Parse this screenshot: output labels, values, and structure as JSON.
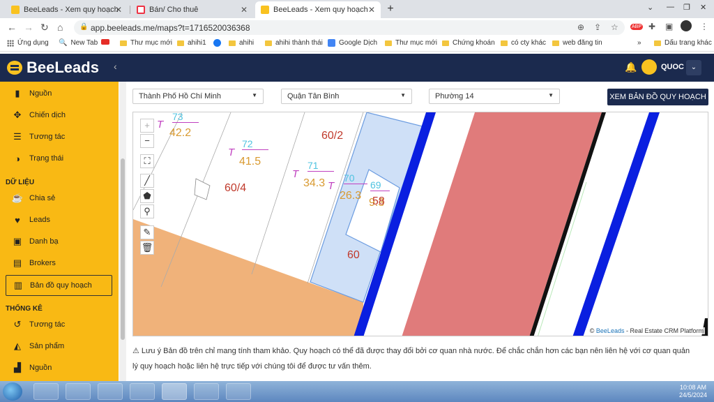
{
  "browser": {
    "tabs": [
      {
        "title": "BeeLeads - Xem quy hoạch",
        "active": false
      },
      {
        "title": "Bán/ Cho thuê",
        "active": false
      },
      {
        "title": "BeeLeads - Xem quy hoạch",
        "active": true
      }
    ],
    "url": "app.beeleads.me/maps?t=1716520036368",
    "bookmarks": [
      "Ứng dụng",
      "New Tab",
      "",
      "Thư mục mới",
      "ahihi1",
      "",
      "ahihi",
      "ahihi thành thái",
      "Google Dịch",
      "Thư mục mới",
      "Chứng khoán",
      "có cty khác",
      "web đăng tin"
    ],
    "more_bookmarks": "»",
    "other_bookmarks": "Dấu trang khác"
  },
  "header": {
    "logo": "BeeLeads",
    "user": "QUOC"
  },
  "sidebar": {
    "items_top": [
      {
        "label": "Nguồn",
        "icon": "bookmark-icon"
      },
      {
        "label": "Chiến dịch",
        "icon": "crosshair-icon"
      },
      {
        "label": "Tương tác",
        "icon": "list-icon"
      },
      {
        "label": "Trạng thái",
        "icon": "half-circle-icon"
      }
    ],
    "section_data": "DỮ LIỆU",
    "items_data": [
      {
        "label": "Chia sẻ",
        "icon": "coffee-icon"
      },
      {
        "label": "Leads",
        "icon": "heartbeat-icon"
      },
      {
        "label": "Danh bạ",
        "icon": "contact-icon"
      },
      {
        "label": "Brokers",
        "icon": "card-icon"
      },
      {
        "label": "Bản đồ quy hoạch",
        "icon": "map-icon",
        "active": true
      }
    ],
    "section_stats": "THỐNG KÊ",
    "items_stats": [
      {
        "label": "Tương tác",
        "icon": "history-icon"
      },
      {
        "label": "Sản phẩm",
        "icon": "area-chart-icon"
      },
      {
        "label": "Nguồn",
        "icon": "bar-chart-icon"
      }
    ]
  },
  "filters": {
    "city": "Thành Phố Hồ Chí Minh",
    "district": "Quận Tân Bình",
    "ward": "Phường 14",
    "view_button": "XEM BẢN ĐỒ QUY HOẠCH"
  },
  "map": {
    "controls": [
      "+",
      "−"
    ],
    "parcels": [
      {
        "prefix": "T",
        "num": "73",
        "area": "42.2"
      },
      {
        "prefix": "T",
        "num": "72",
        "area": "41.5"
      },
      {
        "prefix": "T",
        "num": "71",
        "area": "34.3"
      },
      {
        "prefix": "T",
        "num": "70",
        "area": "26.3"
      },
      {
        "prefix": "",
        "num": "69",
        "area": "9.3"
      }
    ],
    "lot_labels": [
      "60/2",
      "60/4",
      "58",
      "60"
    ],
    "attribution_prefix": "© ",
    "attribution_link": "BeeLeads",
    "attribution_suffix": " - Real Estate CRM Platform"
  },
  "note": "Lưu ý Bản đồ trên chỉ mang tính tham khảo. Quy hoạch có thể đã được thay đổi bởi cơ quan nhà nước. Để chắc chắn hơn các bạn nên liên hệ với cơ quan quản lý quy hoạch hoặc liên hệ trực tiếp với chúng tôi để được tư vấn thêm.",
  "taskbar": {
    "time": "10:08 AM",
    "date": "24/5/2024"
  },
  "colors": {
    "sidebar": "#f9b914",
    "header": "#1b2a4e",
    "road": "#e07b7b",
    "parcel_blue": "#cfe0f7",
    "orange_zone": "#f0b27a",
    "boundary_blue": "#0a1fe0"
  }
}
